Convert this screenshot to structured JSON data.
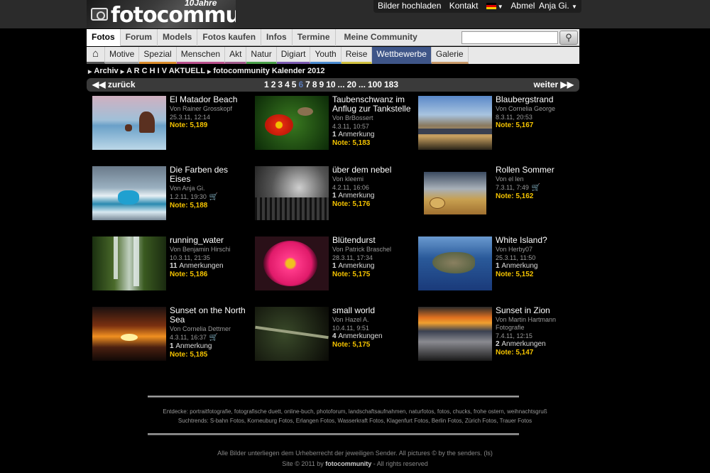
{
  "header": {
    "logo_text": "fotocommunity",
    "logo_badge": "10Jahre",
    "links": [
      "Bilder hochladen",
      "Kontakt",
      "Abmelden"
    ],
    "user": "Anja Gi."
  },
  "main_nav": {
    "items": [
      "Fotos",
      "Forum",
      "Models",
      "Fotos kaufen",
      "Infos",
      "Termine"
    ],
    "my_community": "Meine Community",
    "search_placeholder": ""
  },
  "sub_nav": {
    "items": [
      "Motive",
      "Spezial",
      "Menschen",
      "Akt",
      "Natur",
      "Digiart",
      "Youth",
      "Reise",
      "Wettbewerbe",
      "Galerie"
    ],
    "active": "Wettbewerbe",
    "colors": [
      "#9a9a9a",
      "#d98a2a",
      "#b84e8a",
      "#a05a8a",
      "#4aa04a",
      "#7a5ab0",
      "#4a8ad0",
      "#d0c040",
      "#3e5588",
      "#c89a6a"
    ]
  },
  "breadcrumb": [
    "Archiv",
    "A R C H I V AKTUELL",
    "fotocommunity Kalender 2012"
  ],
  "pager": {
    "prev": "zurück",
    "next": "weiter",
    "pages": [
      "1",
      "2",
      "3",
      "4",
      "5",
      "6",
      "7",
      "8",
      "9",
      "10",
      "...",
      "20",
      "...",
      "100",
      "183"
    ],
    "current": "6"
  },
  "photos": [
    {
      "title": "El Matador Beach",
      "by": "Von Rainer Grosskopf",
      "date": "25.3.11, 12:14",
      "notes_count": "",
      "notes_label": "",
      "score": "Note: 5,189",
      "cart": false
    },
    {
      "title": "Taubenschwanz im Anflug zur Tankstelle",
      "by": "Von BrBossert",
      "date": "4.3.11, 10:57",
      "notes_count": "1",
      "notes_label": "Anmerkung",
      "score": "Note: 5,183",
      "cart": false
    },
    {
      "title": "Blaubergstrand",
      "by": "Von Cornelia George",
      "date": "8.3.11, 20:53",
      "notes_count": "",
      "notes_label": "",
      "score": "Note: 5,167",
      "cart": false
    },
    {
      "title": "Die Farben des Eises",
      "by": "Von Anja Gi.",
      "date": "1.2.11, 19:30",
      "notes_count": "",
      "notes_label": "",
      "score": "Note: 5,188",
      "cart": true
    },
    {
      "title": "über dem nebel",
      "by": "Von kleemi",
      "date": "4.2.11, 16:06",
      "notes_count": "1",
      "notes_label": "Anmerkung",
      "score": "Note: 5,176",
      "cart": false
    },
    {
      "title": "Rollen Sommer",
      "by": "Von el len",
      "date": "7.3.11, 7:49",
      "notes_count": "",
      "notes_label": "",
      "score": "Note: 5,162",
      "cart": true
    },
    {
      "title": "running_water",
      "by": "Von Benjamin Hirschi",
      "date": "10.3.11, 21:35",
      "notes_count": "11",
      "notes_label": "Anmerkungen",
      "score": "Note: 5,186",
      "cart": false
    },
    {
      "title": "Blütendurst",
      "by": "Von Patrick Braschel",
      "date": "28.3.11, 17:34",
      "notes_count": "1",
      "notes_label": "Anmerkung",
      "score": "Note: 5,175",
      "cart": false
    },
    {
      "title": "White Island?",
      "by": "Von Herby07",
      "date": "25.3.11, 11:50",
      "notes_count": "1",
      "notes_label": "Anmerkung",
      "score": "Note: 5,152",
      "cart": false
    },
    {
      "title": "Sunset on the North Sea",
      "by": "Von Cornelia Dettmer",
      "date": "4.3.11, 16:37",
      "notes_count": "1",
      "notes_label": "Anmerkung",
      "score": "Note: 5,185",
      "cart": true
    },
    {
      "title": "small world",
      "by": "Von Hazel A.",
      "date": "10.4.11, 9:51",
      "notes_count": "4",
      "notes_label": "Anmerkungen",
      "score": "Note: 5,175",
      "cart": false
    },
    {
      "title": "Sunset in Zion",
      "by": "Von Martin Hartmann Fotografie",
      "date": "7.4.11, 12:15",
      "notes_count": "2",
      "notes_label": "Anmerkungen",
      "score": "Note: 5,147",
      "cart": false
    }
  ],
  "footer": {
    "discover": "Entdecke: portraitfotografie, fotografische duett, online-buch, photoforum, landschaftsaufnahmen, naturfotos, fotos, chucks, frohe ostern, weihnachtsgruß",
    "trends": "Suchtrends: S-bahn Fotos, Korneuburg Fotos, Erlangen Fotos, Wasserkraft Fotos, Klagenfurt Fotos, Berlin Fotos, Zürich Fotos, Trauer Fotos",
    "copyright": "Alle Bilder unterliegen dem Urheberrecht der jeweiligen Sender. All pictures © by the senders. (ls)",
    "site_prefix": "Site © 2011 by",
    "site_name": "fotocommunity",
    "site_suffix": "- All rights reserved"
  }
}
